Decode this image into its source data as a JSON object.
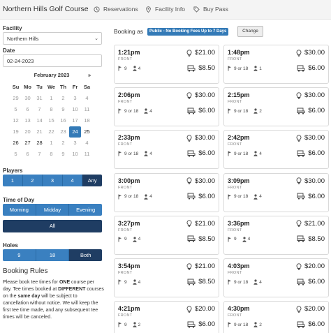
{
  "header": {
    "course_name": "Northern Hills Golf Course",
    "nav": [
      {
        "label": "Reservations",
        "icon": "clock-icon"
      },
      {
        "label": "Facility Info",
        "icon": "location-pin-icon"
      },
      {
        "label": "Buy Pass",
        "icon": "tag-icon"
      }
    ]
  },
  "sidebar": {
    "facility_label": "Facility",
    "facility_value": "Northern Hills",
    "date_label": "Date",
    "date_value": "02-24-2023",
    "calendar": {
      "month": "February 2023",
      "next": "»",
      "dow": [
        "Su",
        "Mo",
        "Tu",
        "We",
        "Th",
        "Fr",
        "Sa"
      ],
      "weeks": [
        [
          "29",
          "30",
          "31",
          "1",
          "2",
          "3",
          "4"
        ],
        [
          "5",
          "6",
          "7",
          "8",
          "9",
          "10",
          "11"
        ],
        [
          "12",
          "13",
          "14",
          "15",
          "16",
          "17",
          "18"
        ],
        [
          "19",
          "20",
          "21",
          "22",
          "23",
          "24",
          "25"
        ],
        [
          "26",
          "27",
          "28",
          "1",
          "2",
          "3",
          "4"
        ],
        [
          "5",
          "6",
          "7",
          "8",
          "9",
          "10",
          "11"
        ]
      ],
      "selected": "24"
    },
    "players_label": "Players",
    "players_options": [
      "1",
      "2",
      "3",
      "4",
      "Any"
    ],
    "players_selected": "Any",
    "time_label": "Time of Day",
    "time_options": [
      "Morning",
      "Midday",
      "Evening"
    ],
    "time_all": "All",
    "holes_label": "Holes",
    "holes_options": [
      "9",
      "18",
      "Both"
    ],
    "holes_selected": "Both",
    "rules_title": "Booking Rules",
    "rules_text": [
      "Please book tee times for ",
      "ONE",
      " course per day. Tee times booked at ",
      "DIFFERENT",
      " courses on the ",
      "same day",
      " will be subject to cancellation without notice. We will keep the first tee time made, and any subsequent tee times will be canceled."
    ]
  },
  "booking": {
    "label": "Booking as",
    "rate": "Public - No Booking Fees Up to 7 Days",
    "change": "Change"
  },
  "tee_times": [
    {
      "time": "1:21pm",
      "side": "FRONT",
      "holes": "9",
      "players": "4",
      "green_fee": "$21.00",
      "cart_fee": "$8.50"
    },
    {
      "time": "1:48pm",
      "side": "FRONT",
      "holes": "9 or 18",
      "players": "1",
      "green_fee": "$30.00",
      "cart_fee": "$6.00"
    },
    {
      "time": "2:06pm",
      "side": "FRONT",
      "holes": "9 or 18",
      "players": "4",
      "green_fee": "$30.00",
      "cart_fee": "$6.00"
    },
    {
      "time": "2:15pm",
      "side": "FRONT",
      "holes": "9 or 18",
      "players": "2",
      "green_fee": "$30.00",
      "cart_fee": "$6.00"
    },
    {
      "time": "2:33pm",
      "side": "FRONT",
      "holes": "9 or 18",
      "players": "4",
      "green_fee": "$30.00",
      "cart_fee": "$6.00"
    },
    {
      "time": "2:42pm",
      "side": "FRONT",
      "holes": "9 or 18",
      "players": "4",
      "green_fee": "$30.00",
      "cart_fee": "$6.00"
    },
    {
      "time": "3:00pm",
      "side": "FRONT",
      "holes": "9 or 18",
      "players": "4",
      "green_fee": "$30.00",
      "cart_fee": "$6.00"
    },
    {
      "time": "3:09pm",
      "side": "FRONT",
      "holes": "9 or 18",
      "players": "4",
      "green_fee": "$30.00",
      "cart_fee": "$6.00"
    },
    {
      "time": "3:27pm",
      "side": "FRONT",
      "holes": "9",
      "players": "4",
      "green_fee": "$21.00",
      "cart_fee": "$8.50"
    },
    {
      "time": "3:36pm",
      "side": "FRONT",
      "holes": "9",
      "players": "4",
      "green_fee": "$21.00",
      "cart_fee": "$8.50"
    },
    {
      "time": "3:54pm",
      "side": "FRONT",
      "holes": "9",
      "players": "4",
      "green_fee": "$21.00",
      "cart_fee": "$8.50"
    },
    {
      "time": "4:03pm",
      "side": "FRONT",
      "holes": "9 or 18",
      "players": "4",
      "green_fee": "$20.00",
      "cart_fee": "$6.00"
    },
    {
      "time": "4:21pm",
      "side": "FRONT",
      "holes": "9",
      "players": "2",
      "green_fee": "$20.00",
      "cart_fee": "$6.00"
    },
    {
      "time": "4:30pm",
      "side": "FRONT",
      "holes": "9 or 18",
      "players": "2",
      "green_fee": "$20.00",
      "cart_fee": "$6.00"
    }
  ]
}
